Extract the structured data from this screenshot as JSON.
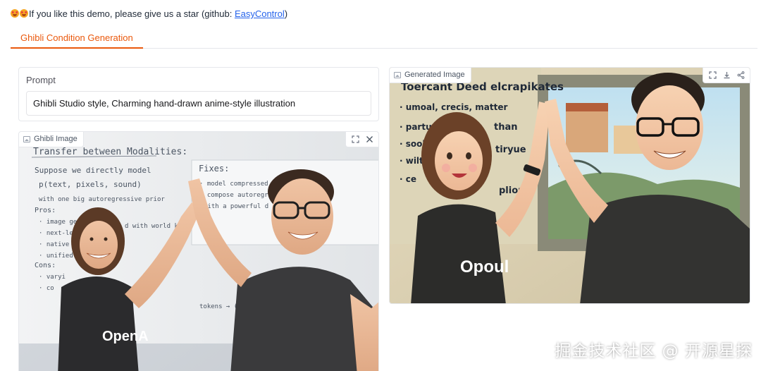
{
  "banner": {
    "emoji": "😍😍",
    "text": "If you like this demo, please give us a star (github: ",
    "link_label": "EasyControl",
    "suffix": ")"
  },
  "tabs": [
    {
      "label": "Ghibli Condition Generation",
      "active": true
    }
  ],
  "prompt": {
    "label": "Prompt",
    "value": "Ghibli Studio style, Charming hand-drawn anime-style illustration"
  },
  "input_image": {
    "label": "Ghibli Image",
    "whiteboard_title": "Transfer between Modalities:",
    "whiteboard_lines": [
      "Suppose we directly model",
      "p(text, pixels, sound)",
      "with one big autoregressive prior",
      "Pros:",
      "· image gen",
      "· next-lev",
      "· native",
      "· unified",
      "Cons:",
      "· varyi",
      "· co"
    ],
    "fixes_title": "Fixes:",
    "fixes_lines": [
      "· model compressed rep",
      "· compose autoregress",
      "with a powerful d"
    ],
    "fragment_1": "d with world kno",
    "fragment_2": "tokens → (transf",
    "shirt_text": "OpenA"
  },
  "output_image": {
    "label": "Generated Image",
    "whiteboard_title": "Toercant Deed elcrapikates",
    "whiteboard_lines": [
      "· umoal, crecis, matter",
      "· parturr",
      "· sook:",
      "· wilt",
      "· ce"
    ],
    "right_words": [
      "than",
      "tiryue",
      "plion"
    ],
    "shirt_text": "Opoul"
  },
  "watermark": "掘金技术社区 @ 开源星探",
  "colors": {
    "accent": "#ea580c",
    "link": "#2563eb",
    "border": "#e5e7eb"
  }
}
